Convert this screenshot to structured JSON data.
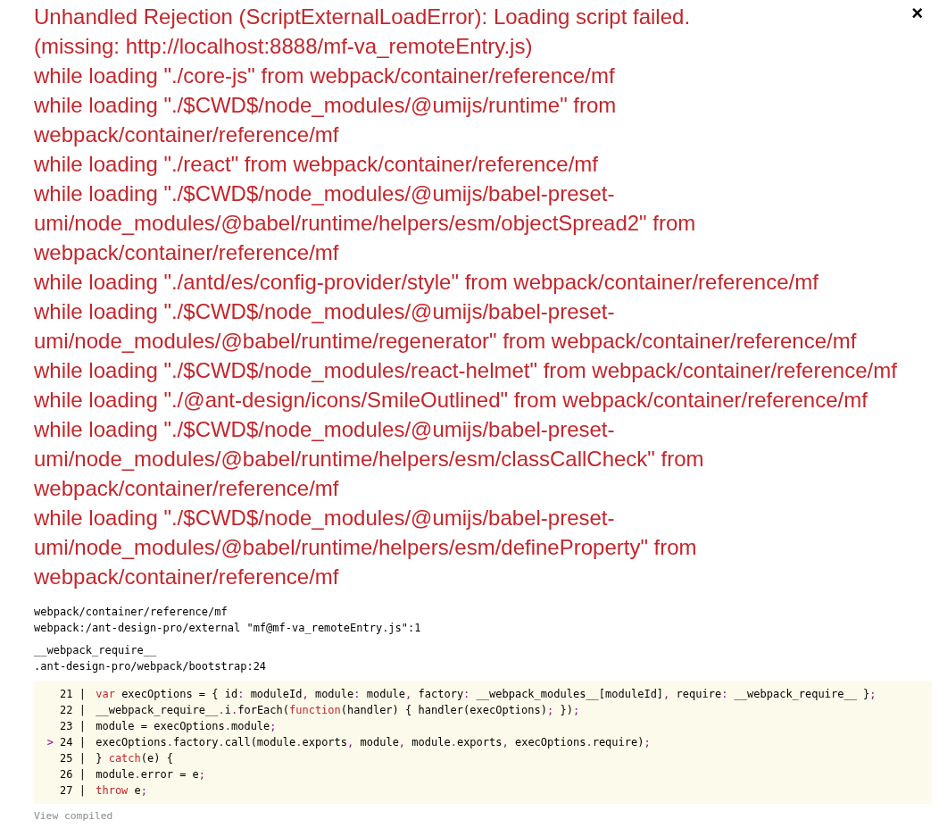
{
  "close": "×",
  "message_lines": [
    "Unhandled Rejection (ScriptExternalLoadError): Loading script failed.",
    "(missing: http://localhost:8888/mf-va_remoteEntry.js)",
    "while loading \"./core-js\" from webpack/container/reference/mf",
    "while loading \"./$CWD$/node_modules/@umijs/runtime\" from",
    "webpack/container/reference/mf",
    "while loading \"./react\" from webpack/container/reference/mf",
    "while loading \"./$CWD$/node_modules/@umijs/babel-preset-",
    "umi/node_modules/@babel/runtime/helpers/esm/objectSpread2\" from",
    "webpack/container/reference/mf",
    "while loading \"./antd/es/config-provider/style\" from webpack/container/reference/mf",
    "while loading \"./$CWD$/node_modules/@umijs/babel-preset-",
    "umi/node_modules/@babel/runtime/regenerator\" from webpack/container/reference/mf",
    "while loading \"./$CWD$/node_modules/react-helmet\" from webpack/container/reference/mf",
    "while loading \"./@ant-design/icons/SmileOutlined\" from webpack/container/reference/mf",
    "while loading \"./$CWD$/node_modules/@umijs/babel-preset-",
    "umi/node_modules/@babel/runtime/helpers/esm/classCallCheck\" from",
    "webpack/container/reference/mf",
    "while loading \"./$CWD$/node_modules/@umijs/babel-preset-",
    "umi/node_modules/@babel/runtime/helpers/esm/defineProperty\" from",
    "webpack/container/reference/mf"
  ],
  "stack_frames": [
    {
      "function": "webpack/container/reference/mf",
      "location": "webpack:/ant-design-pro/external \"mf@mf-va_remoteEntry.js\":1"
    },
    {
      "function": "__webpack_require__",
      "location": ".ant-design-pro/webpack/bootstrap:24"
    }
  ],
  "code_lines": [
    {
      "gutter": "21 |",
      "tokens": [
        {
          "text": "var",
          "kind": "keyword"
        },
        {
          "text": " execOptions = { id"
        },
        {
          "text": ":",
          "kind": "punct"
        },
        {
          "text": " moduleId"
        },
        {
          "text": ",",
          "kind": "punct"
        },
        {
          "text": " module"
        },
        {
          "text": ":",
          "kind": "punct"
        },
        {
          "text": " module"
        },
        {
          "text": ",",
          "kind": "punct"
        },
        {
          "text": " factory"
        },
        {
          "text": ":",
          "kind": "punct"
        },
        {
          "text": " __webpack_modules__[moduleId]"
        },
        {
          "text": ",",
          "kind": "punct"
        },
        {
          "text": " require"
        },
        {
          "text": ":",
          "kind": "punct"
        },
        {
          "text": " __webpack_require__ }"
        },
        {
          "text": ";",
          "kind": "punct"
        }
      ]
    },
    {
      "gutter": "22 |",
      "tokens": [
        {
          "text": "__webpack_require__"
        },
        {
          "text": ".",
          "kind": "punct"
        },
        {
          "text": "i"
        },
        {
          "text": ".",
          "kind": "punct"
        },
        {
          "text": "forEach("
        },
        {
          "text": "function",
          "kind": "keyword"
        },
        {
          "text": "(handler) { handler(execOptions)"
        },
        {
          "text": ";",
          "kind": "punct"
        },
        {
          "text": " })"
        },
        {
          "text": ";",
          "kind": "punct"
        }
      ]
    },
    {
      "gutter": "23 |",
      "tokens": [
        {
          "text": "module = execOptions"
        },
        {
          "text": ".",
          "kind": "punct"
        },
        {
          "text": "module"
        },
        {
          "text": ";",
          "kind": "punct"
        }
      ]
    },
    {
      "gutter": "24 |",
      "marker": ">",
      "tokens": [
        {
          "text": "execOptions"
        },
        {
          "text": ".",
          "kind": "punct"
        },
        {
          "text": "factory"
        },
        {
          "text": ".",
          "kind": "punct"
        },
        {
          "text": "call(module"
        },
        {
          "text": ".",
          "kind": "punct"
        },
        {
          "text": "exports"
        },
        {
          "text": ",",
          "kind": "punct"
        },
        {
          "text": " module"
        },
        {
          "text": ",",
          "kind": "punct"
        },
        {
          "text": " module"
        },
        {
          "text": ".",
          "kind": "punct"
        },
        {
          "text": "exports"
        },
        {
          "text": ",",
          "kind": "punct"
        },
        {
          "text": " execOptions"
        },
        {
          "text": ".",
          "kind": "punct"
        },
        {
          "text": "require)"
        },
        {
          "text": ";",
          "kind": "punct"
        }
      ]
    },
    {
      "gutter": "25 |",
      "tokens": [
        {
          "text": "} "
        },
        {
          "text": "catch",
          "kind": "keyword"
        },
        {
          "text": "(e) {"
        }
      ]
    },
    {
      "gutter": "26 |",
      "tokens": [
        {
          "text": "module"
        },
        {
          "text": ".",
          "kind": "punct"
        },
        {
          "text": "error = e"
        },
        {
          "text": ";",
          "kind": "punct"
        }
      ]
    },
    {
      "gutter": "27 |",
      "tokens": [
        {
          "text": "throw",
          "kind": "keyword"
        },
        {
          "text": " e"
        },
        {
          "text": ";",
          "kind": "punct"
        }
      ]
    }
  ],
  "view_compiled": "View compiled"
}
